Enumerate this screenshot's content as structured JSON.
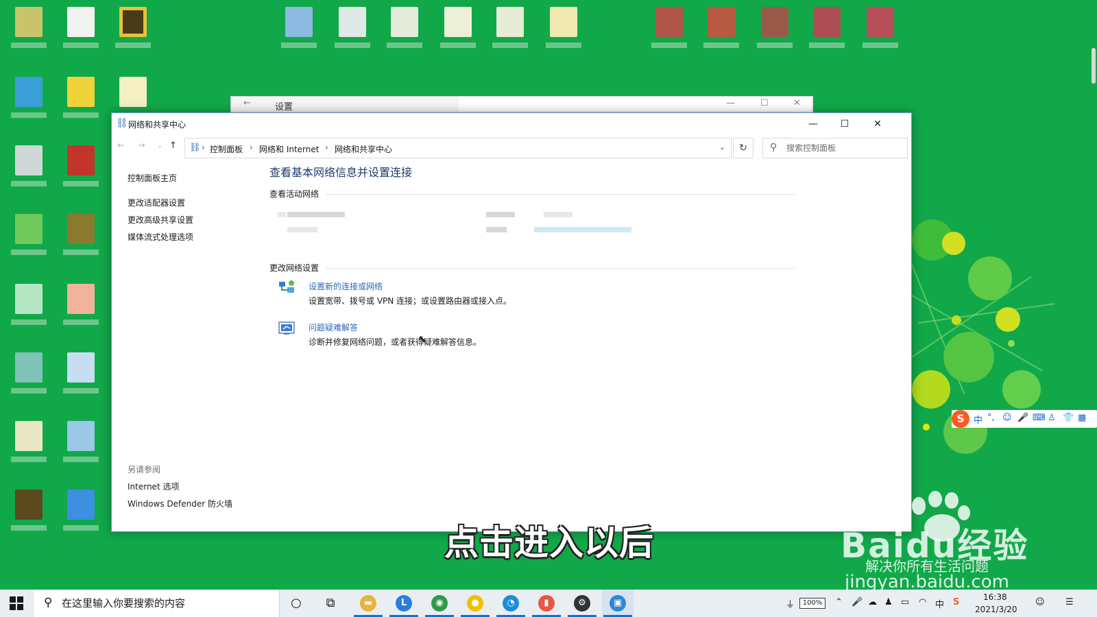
{
  "settings_window": {
    "title": "设置",
    "back_icon": "←",
    "minimize_icon": "—",
    "maximize_icon": "☐",
    "close_icon": "✕"
  },
  "window": {
    "title": "网络和共享中心",
    "title_icon": "network-share-icon",
    "minimize_icon": "—",
    "maximize_icon": "☐",
    "close_icon": "✕"
  },
  "navigation": {
    "back_icon": "←",
    "forward_icon": "→",
    "recent_icon": "⌄",
    "up_icon": "↑",
    "breadcrumb": [
      "控制面板",
      "网络和 Internet",
      "网络和共享中心"
    ],
    "breadcrumb_sep": "›",
    "dropdown_icon": "⌄",
    "refresh_icon": "↻",
    "search_icon": "⚲",
    "search_placeholder": "搜索控制面板"
  },
  "sidebar": {
    "home": "控制面板主页",
    "links": [
      "更改适配器设置",
      "更改高级共享设置",
      "媒体流式处理选项"
    ],
    "see_also_heading": "另请参阅",
    "see_also": [
      "Internet 选项",
      "Windows Defender 防火墙"
    ]
  },
  "main": {
    "heading": "查看基本网络信息并设置连接",
    "active_networks_heading": "查看活动网络",
    "change_settings_heading": "更改网络设置",
    "tasks": [
      {
        "icon": "network-setup-icon",
        "link": "设置新的连接或网络",
        "description": "设置宽带、拨号或 VPN 连接；或设置路由器或接入点。"
      },
      {
        "icon": "troubleshoot-icon",
        "link": "问题疑难解答",
        "description": "诊断并修复网络问题，或者获得疑难解答信息。"
      }
    ]
  },
  "overlay": {
    "caption": "点击进入以后",
    "watermark_brand": "Baidu经验",
    "watermark_slogan": "解决你所有生活问题",
    "watermark_url": "jingyan.baidu.com"
  },
  "ime_toolbar": {
    "logo": "S",
    "items": [
      "中",
      "°,",
      "☺",
      "🎤",
      "⌨",
      "♙",
      "👕",
      "▦"
    ]
  },
  "taskbar": {
    "search_icon": "⚲",
    "search_placeholder": "在这里输入你要搜索的内容",
    "cortana_icon": "○",
    "task_view_icon": "⧉",
    "apps": [
      {
        "name": "file-explorer",
        "glyph": "▬",
        "color": "#e8b33a",
        "active": false
      },
      {
        "name": "l-app",
        "glyph": "L",
        "color": "#2a7de1",
        "active": false
      },
      {
        "name": "browser-c",
        "glyph": "◉",
        "color": "#2f9a4a",
        "active": false
      },
      {
        "name": "bulb-app",
        "glyph": "●",
        "color": "#f3c000",
        "active": false
      },
      {
        "name": "chat-app",
        "glyph": "◔",
        "color": "#1b8ddb",
        "active": false
      },
      {
        "name": "slides-app",
        "glyph": "▮",
        "color": "#e8573f",
        "active": false
      },
      {
        "name": "settings-app",
        "glyph": "⚙",
        "color": "#333333",
        "active": false
      },
      {
        "name": "control-panel-app",
        "glyph": "▣",
        "color": "#2b88d8",
        "active": true
      }
    ],
    "battery": "100%",
    "tray_icons": [
      "⌃",
      "☁",
      "♟",
      "▭",
      "◠",
      "中",
      "S"
    ],
    "time": "16:38",
    "date": "2021/3/20",
    "notification_icon": "☰"
  },
  "colors": {
    "desktop": "#11a84a",
    "link": "#2a68b8",
    "heading": "#1e3a6e",
    "accent": "#0078d7"
  }
}
